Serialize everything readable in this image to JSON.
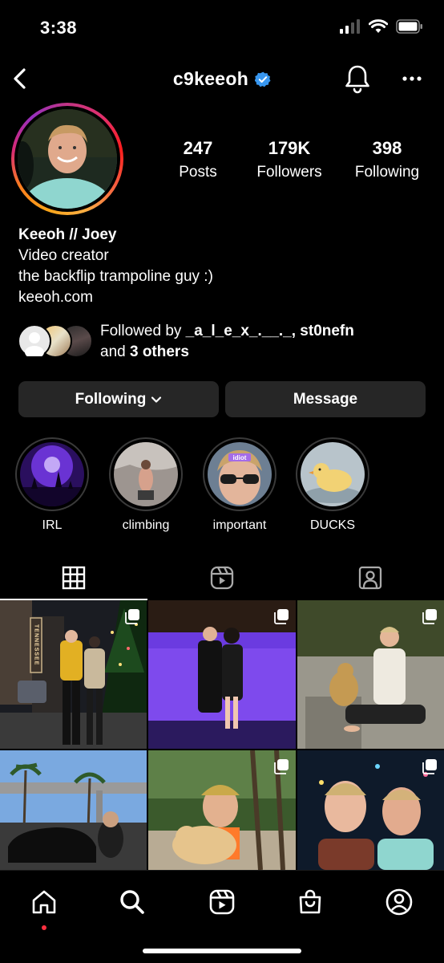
{
  "status_bar": {
    "time": "3:38",
    "icons": [
      "signal-icon",
      "wifi-icon",
      "battery-icon"
    ]
  },
  "header": {
    "username": "c9keeoh",
    "verified": true,
    "icons": [
      "back-arrow-icon",
      "bell-icon",
      "more-dots-icon"
    ],
    "colors": {
      "verified_badge": "#3897f0"
    }
  },
  "profile": {
    "stats": [
      {
        "value": "247",
        "label": "Posts"
      },
      {
        "value": "179K",
        "label": "Followers"
      },
      {
        "value": "398",
        "label": "Following"
      }
    ],
    "bio": {
      "name": "Keeoh // Joey",
      "category": "Video creator",
      "text": "the backflip trampoline guy :)",
      "link": "keeoh.com"
    },
    "followed_by": {
      "prefix": "Followed by ",
      "users": "_a_l_e_x_.__._, st0nefn",
      "and": "and ",
      "others": "3 others"
    }
  },
  "actions": {
    "following_label": "Following",
    "message_label": "Message"
  },
  "highlights": [
    {
      "label": "IRL"
    },
    {
      "label": "climbing"
    },
    {
      "label": "important",
      "sticker": "idiot"
    },
    {
      "label": "DUCKS"
    }
  ],
  "tabs": [
    {
      "icon": "grid-icon",
      "active": true
    },
    {
      "icon": "reels-icon",
      "active": false
    },
    {
      "icon": "tagged-icon",
      "active": false
    }
  ],
  "posts": [
    {
      "sign_text": "TENNESSEE",
      "multi": true
    },
    {
      "multi": true
    },
    {
      "multi": true
    },
    {
      "multi": false
    },
    {
      "multi": true
    },
    {
      "multi": true
    }
  ],
  "bottom_nav": [
    "home-icon",
    "search-icon",
    "reels-icon",
    "shop-icon",
    "profile-icon"
  ],
  "colors": {
    "background": "#000000",
    "button_bg": "#262626",
    "notification_dot": "#ff3040"
  }
}
